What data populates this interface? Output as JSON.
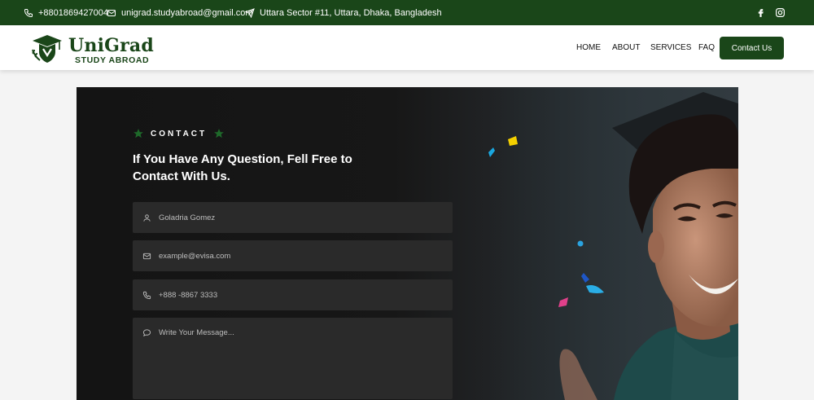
{
  "topbar": {
    "phone": "+8801869427004",
    "email": "unigrad.studyabroad@gmail.com",
    "address": "Uttara Sector #11, Uttara, Dhaka, Bangladesh",
    "socials": [
      "facebook-icon",
      "instagram-icon"
    ]
  },
  "brand": {
    "name": "UniGrad",
    "tagline": "STUDY ABROAD",
    "color": "#1a4619"
  },
  "nav": {
    "items": [
      "HOME",
      "ABOUT",
      "SERVICES",
      "FAQ"
    ],
    "cta": "Contact Us"
  },
  "contact": {
    "eyebrow": "CONTACT",
    "heading": "If You Have Any Question, Fell Free to Contact With Us.",
    "fields": {
      "name": {
        "placeholder": "Goladria Gomez",
        "icon": "user-icon"
      },
      "email": {
        "placeholder": "example@evisa.com",
        "icon": "mail-icon"
      },
      "phone": {
        "placeholder": "+888 -8867 3333",
        "icon": "phone-icon"
      },
      "message": {
        "placeholder": "Write Your Message...",
        "icon": "chat-icon"
      }
    }
  }
}
